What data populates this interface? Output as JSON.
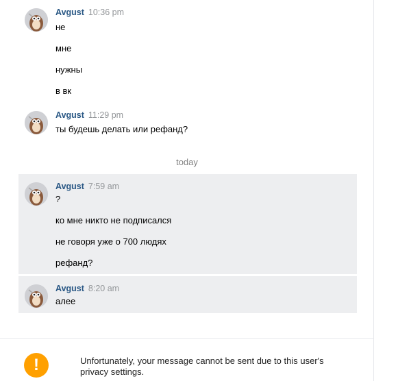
{
  "conversation": {
    "groups": [
      {
        "author": "Avgust",
        "time": "10:36 pm",
        "lines": [
          "не",
          "мне",
          "нужны",
          "в вк"
        ]
      },
      {
        "author": "Avgust",
        "time": "11:29 pm",
        "lines": [
          "ты будешь делать или рефанд?"
        ]
      },
      {
        "author": "Avgust",
        "time": "7:59 am",
        "lines": [
          "?",
          "ко мне никто не подписался",
          "не говоря уже о 700 людях",
          "рефанд?"
        ]
      },
      {
        "author": "Avgust",
        "time": "8:20 am",
        "lines": [
          "алее"
        ]
      }
    ],
    "date_separator": "today"
  },
  "notice": {
    "icon": "warning-icon",
    "icon_symbol": "!",
    "text": "Unfortunately, your message cannot be sent due to this user's privacy settings."
  },
  "colors": {
    "author": "#2a5885",
    "time": "#939699",
    "unread_bg": "#edeef0",
    "warning": "#ffa000"
  }
}
